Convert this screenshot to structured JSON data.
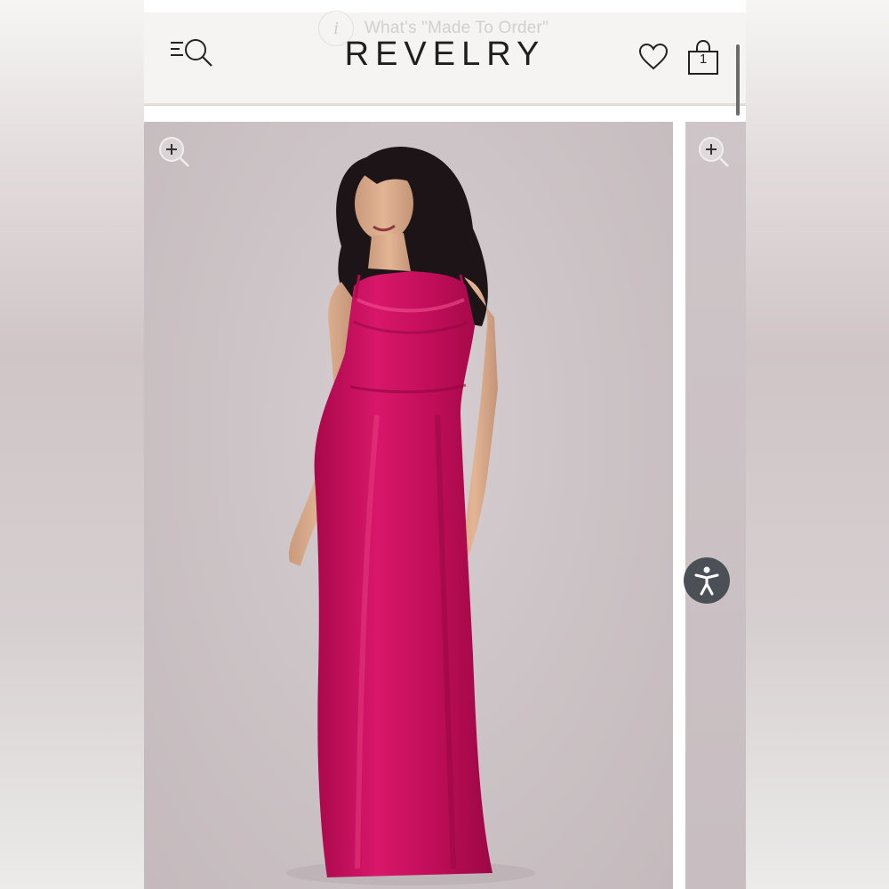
{
  "banner": {
    "info_glyph": "i",
    "text": "What's \"Made To Order\""
  },
  "header": {
    "logo": "REVELRY",
    "menu_search_icon": "menu-search-icon",
    "wishlist_icon": "heart-icon",
    "cart_icon": "shopping-bag-icon",
    "cart_count": "1"
  },
  "gallery": {
    "main_image_alt": "Model wearing a fuchsia satin cowl-neck maxi dress",
    "zoom_icon": "zoom-in-icon",
    "dress_color": "#d0105e"
  },
  "accessibility": {
    "icon": "accessibility-icon",
    "color": "#4b5057"
  }
}
